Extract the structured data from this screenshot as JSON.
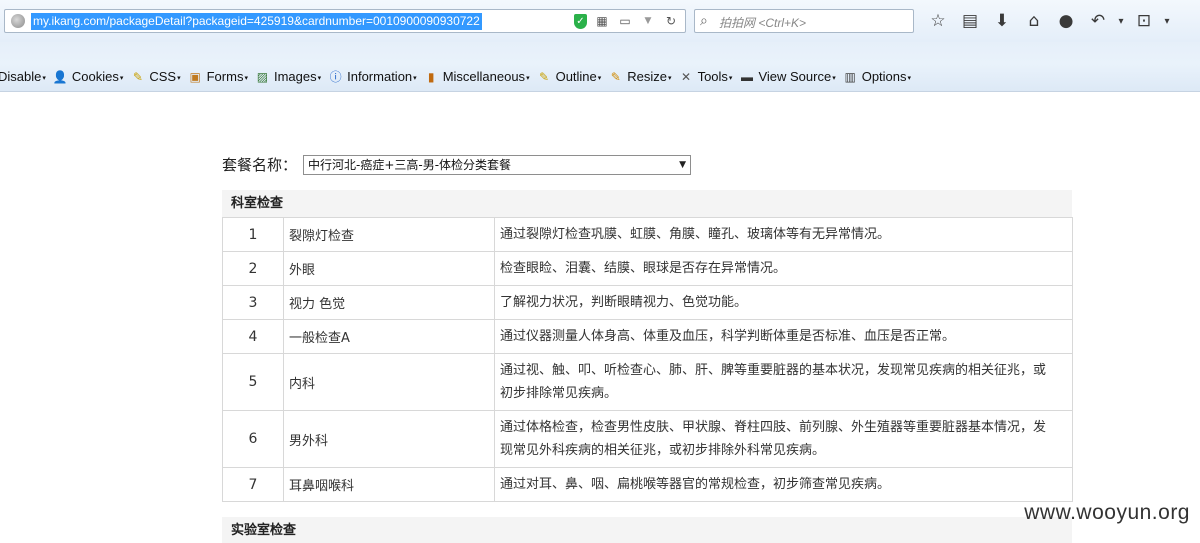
{
  "browser": {
    "url": "my.ikang.com/packageDetail?packageid=425919&cardnumber=0010900090930722",
    "search_placeholder": "拍拍网 <Ctrl+K>"
  },
  "devtoolbar": {
    "items": [
      {
        "label": "Disable",
        "icon": ""
      },
      {
        "label": "Cookies",
        "icon": "cookies-person-icon"
      },
      {
        "label": "CSS",
        "icon": "css-pencil-icon"
      },
      {
        "label": "Forms",
        "icon": "forms-clipboard-icon"
      },
      {
        "label": "Images",
        "icon": "images-picture-icon"
      },
      {
        "label": "Information",
        "icon": "information-icon"
      },
      {
        "label": "Miscellaneous",
        "icon": "miscellaneous-book-icon"
      },
      {
        "label": "Outline",
        "icon": "outline-pencil-icon"
      },
      {
        "label": "Resize",
        "icon": "resize-pencil-icon"
      },
      {
        "label": "Tools",
        "icon": "tools-wrench-icon"
      },
      {
        "label": "View Source",
        "icon": "view-source-monitor-icon"
      },
      {
        "label": "Options",
        "icon": "options-icon"
      }
    ]
  },
  "package": {
    "label": "套餐名称：",
    "selected": "中行河北-癌症+三高-男-体检分类套餐"
  },
  "sections": {
    "department": "科室检查",
    "lab": "实验室检查"
  },
  "exams": [
    {
      "num": "1",
      "name": "裂隙灯检查",
      "desc": "通过裂隙灯检查巩膜、虹膜、角膜、瞳孔、玻璃体等有无异常情况。"
    },
    {
      "num": "2",
      "name": "外眼",
      "desc": "检查眼睑、泪囊、结膜、眼球是否存在异常情况。"
    },
    {
      "num": "3",
      "name": "视力 色觉",
      "desc": "了解视力状况，判断眼睛视力、色觉功能。"
    },
    {
      "num": "4",
      "name": "一般检查A",
      "desc": "通过仪器测量人体身高、体重及血压，科学判断体重是否标准、血压是否正常。"
    },
    {
      "num": "5",
      "name": "内科",
      "desc": "通过视、触、叩、听检查心、肺、肝、脾等重要脏器的基本状况，发现常见疾病的相关征兆，或初步排除常见疾病。"
    },
    {
      "num": "6",
      "name": "男外科",
      "desc": "通过体格检查，检查男性皮肤、甲状腺、脊柱四肢、前列腺、外生殖器等重要脏器基本情况，发现常见外科疾病的相关征兆，或初步排除外科常见疾病。"
    },
    {
      "num": "7",
      "name": "耳鼻咽喉科",
      "desc": "通过对耳、鼻、咽、扁桃喉等器官的常规检查，初步筛查常见疾病。"
    }
  ],
  "watermark": "www.wooyun.org"
}
